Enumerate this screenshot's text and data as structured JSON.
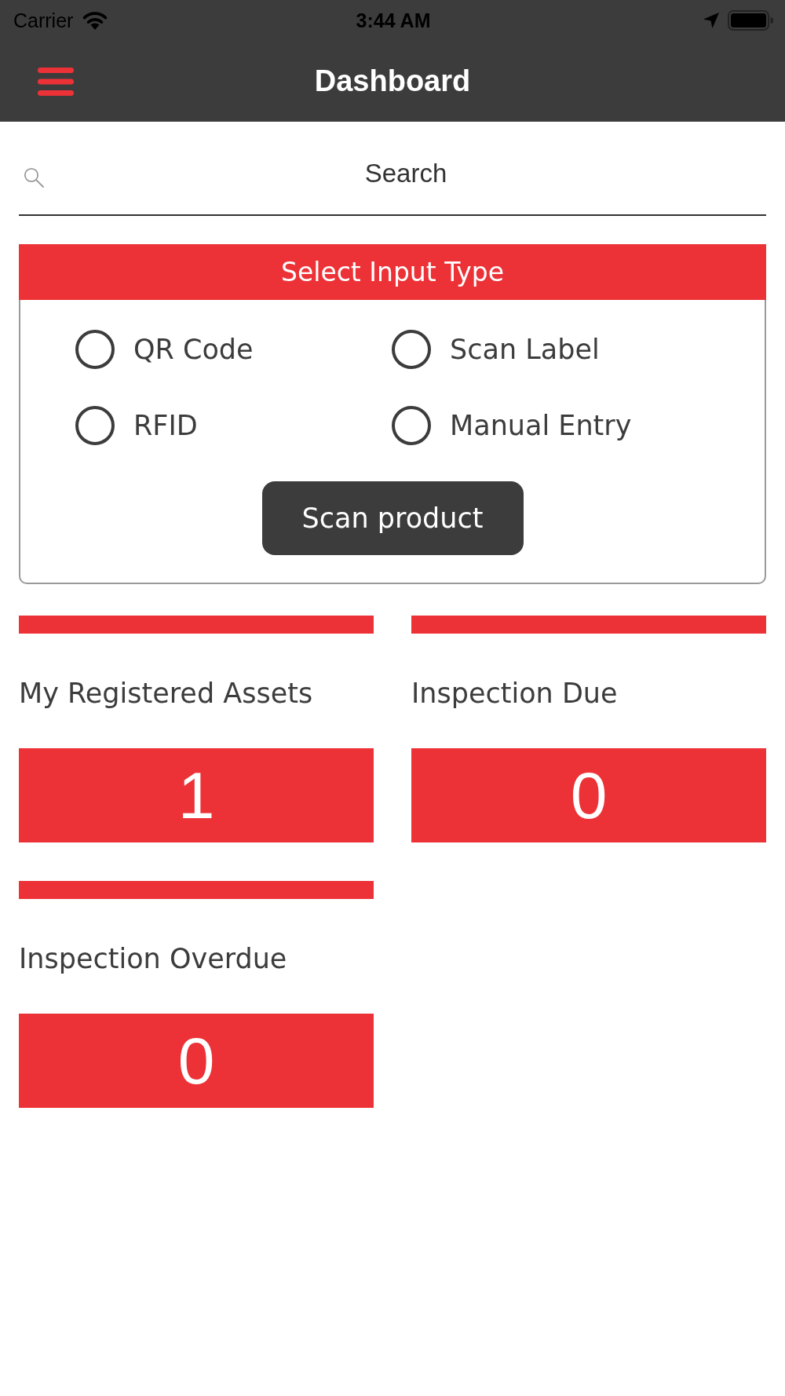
{
  "status_bar": {
    "carrier": "Carrier",
    "time": "3:44 AM"
  },
  "header": {
    "title": "Dashboard"
  },
  "search": {
    "placeholder": "Search"
  },
  "input_type": {
    "title": "Select Input Type",
    "options": [
      {
        "label": "QR Code",
        "selected": false
      },
      {
        "label": "Scan Label",
        "selected": false
      },
      {
        "label": "RFID",
        "selected": false
      },
      {
        "label": "Manual Entry",
        "selected": false
      }
    ],
    "button": "Scan product"
  },
  "stats": [
    {
      "label": "My Registered Assets",
      "value": "1"
    },
    {
      "label": "Inspection Due",
      "value": "0"
    },
    {
      "label": "Inspection Overdue",
      "value": "0"
    }
  ]
}
